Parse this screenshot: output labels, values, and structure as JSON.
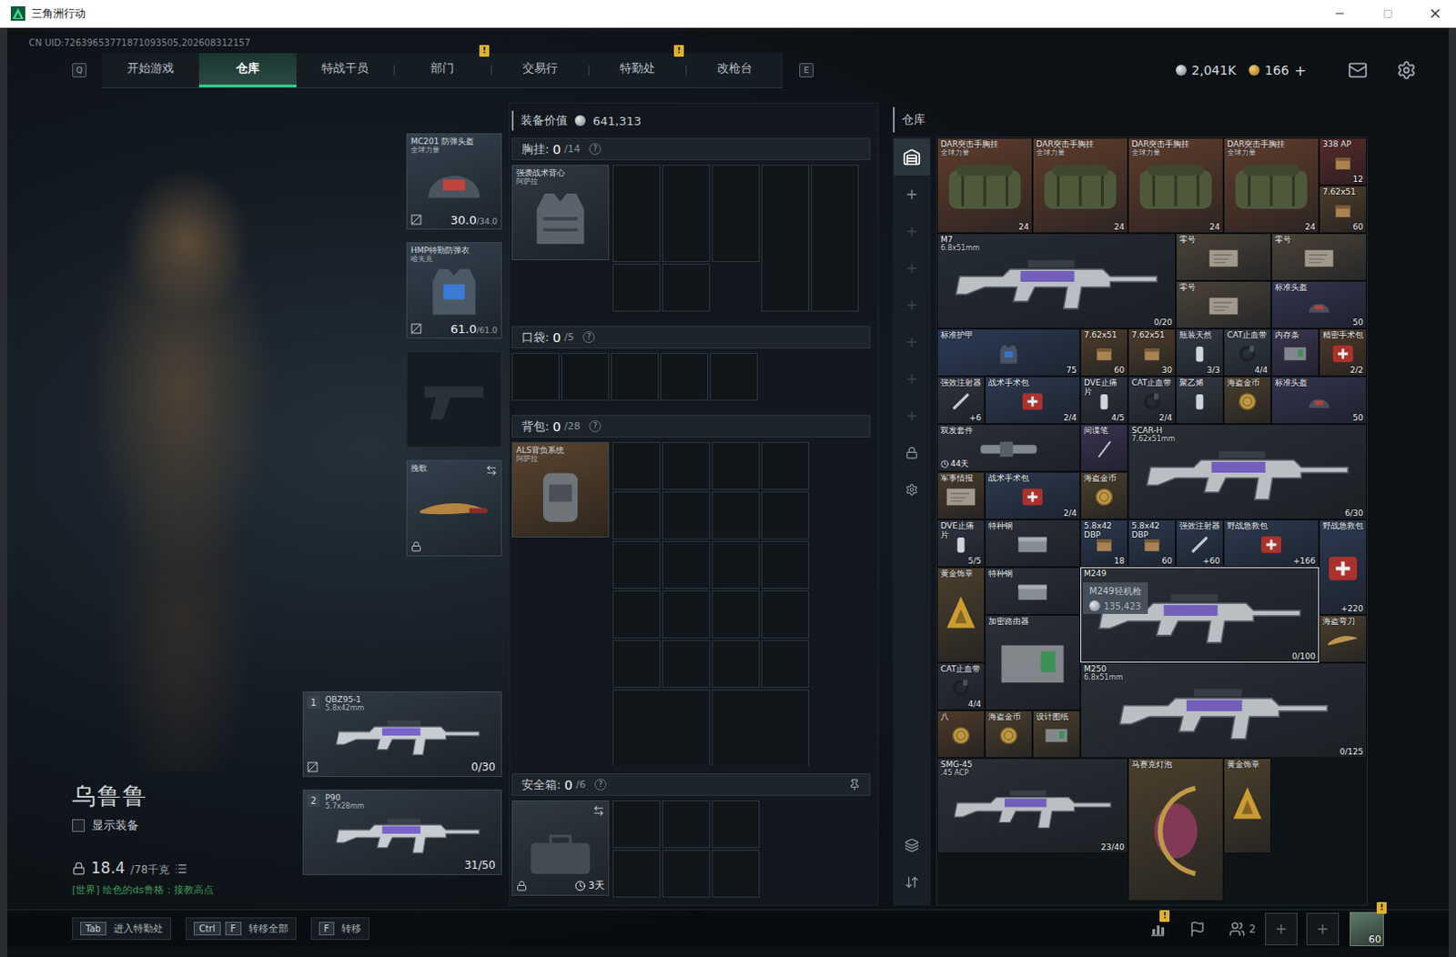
{
  "window": {
    "title": "三角洲行动"
  },
  "uid": "CN UID:72639653771871093505,202608312157",
  "nav": {
    "prev_key": "Q",
    "next_key": "E",
    "alert_mark": "!",
    "tabs": [
      {
        "label": "开始游戏",
        "selected": false,
        "alert": false
      },
      {
        "label": "仓库",
        "selected": true,
        "alert": false
      },
      {
        "label": "特战干员",
        "selected": false,
        "alert": false
      },
      {
        "label": "部门",
        "selected": false,
        "alert": true
      },
      {
        "label": "交易行",
        "selected": false,
        "alert": false
      },
      {
        "label": "特勤处",
        "selected": false,
        "alert": true
      },
      {
        "label": "改枪台",
        "selected": false,
        "alert": false
      }
    ]
  },
  "currencies": [
    {
      "kind": "silver",
      "amount": "2,041K",
      "action": ""
    },
    {
      "kind": "gold",
      "amount": "166",
      "action": "+"
    }
  ],
  "operator": {
    "name": "乌鲁鲁",
    "show_gear": {
      "label": "显示装备",
      "checked": false
    },
    "weight": "18.4",
    "weight_limit": "/78千克",
    "locked": true,
    "chat": "[世界] 绘色的ds鲁格：接教高点"
  },
  "gear_slots": [
    {
      "kind": "helmet",
      "name": "MC201 防弹头盔",
      "sub": "全球力量",
      "durability": "30.0",
      "max": "/34.0",
      "no_insure": true,
      "locked": false,
      "swappable": false,
      "empty": false
    },
    {
      "kind": "armor",
      "name": "HMP特勤防弹衣",
      "sub": "哈夫克",
      "durability": "61.0",
      "max": "/61.0",
      "no_insure": true,
      "locked": false,
      "swappable": false,
      "empty": false
    },
    {
      "kind": "pistol",
      "name": "",
      "sub": "",
      "durability": "",
      "max": "",
      "no_insure": false,
      "locked": false,
      "swappable": false,
      "empty": true
    },
    {
      "kind": "melee",
      "name": "挽歌",
      "sub": "",
      "durability": "",
      "max": "",
      "no_insure": false,
      "locked": true,
      "swappable": true,
      "empty": false
    }
  ],
  "weapons": [
    {
      "index": "1",
      "name": "QBZ95-1",
      "caliber": "5.8x42mm",
      "ammo": "0/30",
      "no_insure": true
    },
    {
      "index": "2",
      "name": "P90",
      "caliber": "5.7x28mm",
      "ammo": "31/50",
      "no_insure": false
    }
  ],
  "loadout": {
    "value_label": "装备价值",
    "value": "641,313",
    "help": "?",
    "rig": {
      "title": "胸挂:",
      "used": "0",
      "capacity": "/14",
      "item": "强袭战术背心",
      "item_sub": "阿萨拉"
    },
    "pockets": {
      "title": "口袋:",
      "used": "0",
      "capacity": "/5"
    },
    "backpack": {
      "title": "背包:",
      "used": "0",
      "capacity": "/28",
      "item": "ALS背负系统",
      "item_sub": "阿萨拉"
    },
    "safe": {
      "title": "安全箱:",
      "used": "0",
      "capacity": "/6",
      "timer": "3天",
      "locked": true,
      "pinned": true
    }
  },
  "warehouse": {
    "title": "仓库",
    "tabs": [
      {
        "kind": "home",
        "selected": true
      },
      {
        "kind": "add",
        "selected": false
      },
      {
        "kind": "empty",
        "selected": false
      },
      {
        "kind": "empty",
        "selected": false
      },
      {
        "kind": "empty",
        "selected": false
      },
      {
        "kind": "empty",
        "selected": false
      },
      {
        "kind": "empty",
        "selected": false
      },
      {
        "kind": "empty",
        "selected": false
      },
      {
        "kind": "locked",
        "selected": false
      },
      {
        "kind": "settings",
        "selected": false
      }
    ],
    "tools": [
      {
        "kind": "layers"
      },
      {
        "kind": "sort"
      }
    ],
    "tooltip": {
      "item": "M249轻机枪",
      "value": "135,423"
    },
    "items": [
      {
        "name": "DAR突击手胸挂",
        "sub": "全球力量",
        "count": "24",
        "kind": "bag",
        "color": "#5f3d2b"
      },
      {
        "name": "DAR突击手胸挂",
        "sub": "全球力量",
        "count": "24",
        "kind": "bag",
        "color": "#5f3d2b"
      },
      {
        "name": "DAR突击手胸挂",
        "sub": "全球力量",
        "count": "24",
        "kind": "bag",
        "color": "#5f3d2b"
      },
      {
        "name": "DAR突击手胸挂",
        "sub": "全球力量",
        "count": "24",
        "kind": "bag",
        "color": "#5f3d2b"
      },
      {
        "name": "338 AP",
        "count": "12",
        "kind": "ammo",
        "color": "#5a2a2a"
      },
      {
        "name": "7.62x51",
        "count": "60",
        "kind": "ammo",
        "color": "#4d3d2a"
      },
      {
        "name": "M7",
        "sub": "6.8x51mm",
        "count": "0/20",
        "kind": "weapon",
        "color": "#262c34"
      },
      {
        "name": "零号",
        "kind": "tablet",
        "color": "#4b4339"
      },
      {
        "name": "零号",
        "kind": "tablet",
        "color": "#4b4339"
      },
      {
        "name": "零号",
        "kind": "tablet",
        "color": "#4b4339"
      },
      {
        "name": "标准头盔",
        "count": "50",
        "kind": "helmet",
        "color": "#34344f"
      },
      {
        "name": "标准护甲",
        "count": "75",
        "kind": "armor",
        "color": "#2c3b55"
      },
      {
        "name": "7.62x51",
        "count": "60",
        "kind": "ammo",
        "color": "#4d3d2a"
      },
      {
        "name": "7.62x51",
        "count": "30",
        "kind": "ammo",
        "color": "#4d3d2a"
      },
      {
        "name": "瓶装天然",
        "count": "3/3",
        "kind": "bottle",
        "color": "#333a44"
      },
      {
        "name": "CAT止血带",
        "count": "4/4",
        "kind": "tourniquet",
        "color": "#333a44"
      },
      {
        "name": "内存条",
        "kind": "device",
        "color": "#3b3550"
      },
      {
        "name": "精密手术包",
        "count": "2/2",
        "kind": "med",
        "color": "#4e3a2a"
      },
      {
        "name": "强效注射器",
        "count": "+6",
        "kind": "injector",
        "color": "#2f3440"
      },
      {
        "name": "战术手术包",
        "count": "2/4",
        "kind": "med",
        "color": "#2c3a50"
      },
      {
        "name": "DVE止痛片",
        "count": "4/5",
        "kind": "bottle",
        "color": "#2f3440"
      },
      {
        "name": "CAT止血带",
        "count": "2/4",
        "kind": "tourniquet",
        "color": "#2f3440"
      },
      {
        "name": "聚乙烯",
        "kind": "bottle",
        "color": "#333a44"
      },
      {
        "name": "海盗金币",
        "kind": "coin",
        "color": "#4b3f2c"
      },
      {
        "name": "标准头盔",
        "count": "50",
        "kind": "helmet",
        "color": "#34344f"
      },
      {
        "name": "双发套件",
        "timer": "44天",
        "kind": "scope",
        "color": "#2b3039"
      },
      {
        "name": "间谍笔",
        "kind": "pen",
        "color": "#3a3350"
      },
      {
        "name": "SCAR-H",
        "sub": "7.62x51mm",
        "count": "6/30",
        "kind": "weapon",
        "color": "#2a2f36"
      },
      {
        "name": "军事情报",
        "kind": "tablet",
        "color": "#4a3b2b"
      },
      {
        "name": "战术手术包",
        "count": "2/4",
        "kind": "med",
        "color": "#2c3a50"
      },
      {
        "name": "海盗金币",
        "kind": "coin",
        "color": "#4b3f2c"
      },
      {
        "name": "DVE止痛片",
        "count": "5/5",
        "kind": "bottle",
        "color": "#2f3440"
      },
      {
        "name": "特种钢",
        "kind": "plate",
        "color": "#2b3039"
      },
      {
        "name": "5.8x42 DBP",
        "count": "18",
        "kind": "ammo",
        "color": "#2c3a50"
      },
      {
        "name": "5.8x42 DBP",
        "count": "60",
        "kind": "ammo",
        "color": "#2c3a50"
      },
      {
        "name": "强效注射器",
        "count": "+60",
        "kind": "injector",
        "color": "#2c3a50"
      },
      {
        "name": "野战急救包",
        "count": "+166",
        "kind": "med",
        "color": "#2c3a50"
      },
      {
        "name": "野战急救包",
        "count": "+220",
        "kind": "med",
        "color": "#2c3a50"
      },
      {
        "name": "黄金饰章",
        "kind": "badge",
        "color": "#4b3f2c"
      },
      {
        "name": "特种钢",
        "kind": "plate",
        "color": "#2b3039"
      },
      {
        "name": "M249",
        "count": "0/100",
        "kind": "weapon",
        "color": "#2a2f36",
        "hovered": true
      },
      {
        "name": "加密路由器",
        "kind": "device",
        "color": "#2b3039"
      },
      {
        "name": "海盗弯刀",
        "kind": "blade",
        "color": "#4b3f2c"
      },
      {
        "name": "CAT止血带",
        "count": "4/4",
        "kind": "tourniquet",
        "color": "#2b3039"
      },
      {
        "name": "M250",
        "sub": "6.8x51mm",
        "count": "0/125",
        "kind": "weapon",
        "color": "#2a2f36"
      },
      {
        "name": "八",
        "kind": "coin",
        "color": "#4e3a2a"
      },
      {
        "name": "海盗金币",
        "kind": "coin",
        "color": "#4b3f2c"
      },
      {
        "name": "设计图纸",
        "kind": "device",
        "color": "#4b3f2c"
      },
      {
        "name": "SMG-45",
        "sub": ".45 ACP",
        "count": "23/40",
        "kind": "weapon",
        "color": "#2a2f36"
      },
      {
        "name": "马赛克灯泡",
        "kind": "lamp",
        "color": "#4b3f2c"
      },
      {
        "name": "黄金饰章",
        "kind": "badge",
        "color": "#4b3f2c"
      }
    ]
  },
  "bottom": {
    "hints": [
      {
        "keys": [
          "Tab"
        ],
        "label": "进入特勤处"
      },
      {
        "keys": [
          "Ctrl",
          "F"
        ],
        "label": "转移全部"
      },
      {
        "keys": [
          "F"
        ],
        "label": "转移"
      }
    ],
    "tools": [
      {
        "kind": "stats",
        "alert": true,
        "count": ""
      },
      {
        "kind": "flag",
        "alert": false,
        "count": ""
      },
      {
        "kind": "squad",
        "alert": false,
        "count": "2"
      }
    ],
    "invite_slots": [
      {
        "filled": false
      },
      {
        "filled": false
      }
    ],
    "profile": {
      "level": "60",
      "alert": true
    }
  }
}
